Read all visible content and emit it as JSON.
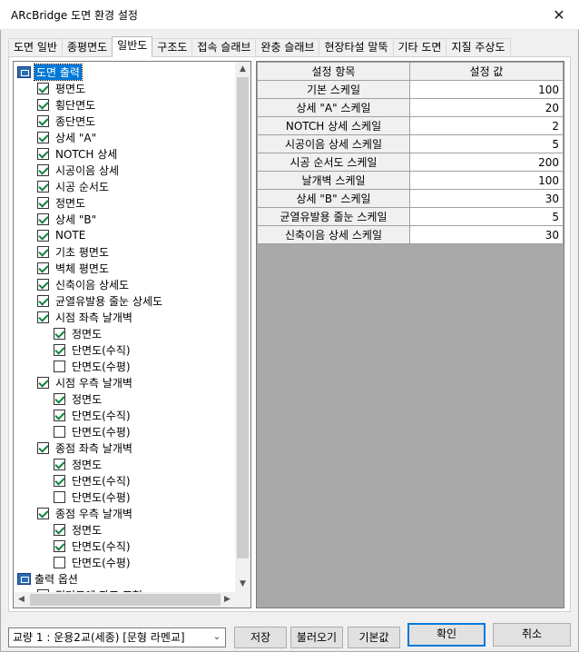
{
  "window": {
    "title": "ARcBridge 도면 환경 설정"
  },
  "tabs": [
    {
      "label": "도면 일반",
      "active": false
    },
    {
      "label": "종평면도",
      "active": false
    },
    {
      "label": "일반도",
      "active": true
    },
    {
      "label": "구조도",
      "active": false
    },
    {
      "label": "접속 슬래브",
      "active": false
    },
    {
      "label": "완충 슬래브",
      "active": false
    },
    {
      "label": "현장타설 말뚝",
      "active": false
    },
    {
      "label": "기타 도면",
      "active": false
    },
    {
      "label": "지질 주상도",
      "active": false
    }
  ],
  "tree": {
    "root_label": "도면 출력",
    "items": [
      {
        "label": "평면도",
        "checked": true,
        "level": 1
      },
      {
        "label": "횡단면도",
        "checked": true,
        "level": 1
      },
      {
        "label": "종단면도",
        "checked": true,
        "level": 1
      },
      {
        "label": "상세 \"A\"",
        "checked": true,
        "level": 1
      },
      {
        "label": "NOTCH 상세",
        "checked": true,
        "level": 1
      },
      {
        "label": "시공이음 상세",
        "checked": true,
        "level": 1
      },
      {
        "label": "시공 순서도",
        "checked": true,
        "level": 1
      },
      {
        "label": "정면도",
        "checked": true,
        "level": 1
      },
      {
        "label": "상세 \"B\"",
        "checked": true,
        "level": 1
      },
      {
        "label": "NOTE",
        "checked": true,
        "level": 1
      },
      {
        "label": "기초 평면도",
        "checked": true,
        "level": 1
      },
      {
        "label": "벽체 평면도",
        "checked": true,
        "level": 1
      },
      {
        "label": "신축이음 상세도",
        "checked": true,
        "level": 1
      },
      {
        "label": "균열유발용 줄눈 상세도",
        "checked": true,
        "level": 1
      },
      {
        "label": "시점 좌측 날개벽",
        "checked": true,
        "level": 1
      },
      {
        "label": "정면도",
        "checked": true,
        "level": 2
      },
      {
        "label": "단면도(수직)",
        "checked": true,
        "level": 2
      },
      {
        "label": "단면도(수평)",
        "checked": false,
        "level": 2
      },
      {
        "label": "시점 우측 날개벽",
        "checked": true,
        "level": 1
      },
      {
        "label": "정면도",
        "checked": true,
        "level": 2
      },
      {
        "label": "단면도(수직)",
        "checked": true,
        "level": 2
      },
      {
        "label": "단면도(수평)",
        "checked": false,
        "level": 2
      },
      {
        "label": "종점 좌측 날개벽",
        "checked": true,
        "level": 1
      },
      {
        "label": "정면도",
        "checked": true,
        "level": 2
      },
      {
        "label": "단면도(수직)",
        "checked": true,
        "level": 2
      },
      {
        "label": "단면도(수평)",
        "checked": false,
        "level": 2
      },
      {
        "label": "종점 우측 날개벽",
        "checked": true,
        "level": 1
      },
      {
        "label": "정면도",
        "checked": true,
        "level": 2
      },
      {
        "label": "단면도(수직)",
        "checked": true,
        "level": 2
      },
      {
        "label": "단면도(수평)",
        "checked": false,
        "level": 2
      }
    ],
    "root2_label": "출력 옵션",
    "partial_item": {
      "label": "평면도에 좌표 표현",
      "checked": true
    }
  },
  "grid": {
    "headers": [
      "설정 항목",
      "설정 값"
    ],
    "rows": [
      {
        "key": "기본 스케일",
        "value": "100"
      },
      {
        "key": "상세 \"A\" 스케일",
        "value": "20"
      },
      {
        "key": "NOTCH 상세 스케일",
        "value": "2"
      },
      {
        "key": "시공이음 상세 스케일",
        "value": "5"
      },
      {
        "key": "시공 순서도 스케일",
        "value": "200"
      },
      {
        "key": "날개벽 스케일",
        "value": "100"
      },
      {
        "key": "상세 \"B\" 스케일",
        "value": "30"
      },
      {
        "key": "균열유발용 줄눈 스케일",
        "value": "5"
      },
      {
        "key": "신축이음 상세 스케일",
        "value": "30"
      }
    ]
  },
  "footer": {
    "bridge_select": "교량 1 : 운용2교(세종) [문형 라멘교]",
    "save_label": "저장",
    "load_label": "불러오기",
    "default_label": "기본값",
    "ok_label": "확인",
    "cancel_label": "취소"
  },
  "colors": {
    "accent": "#0078d7",
    "check": "#15803d",
    "grid_bg": "#a9a9a9"
  }
}
